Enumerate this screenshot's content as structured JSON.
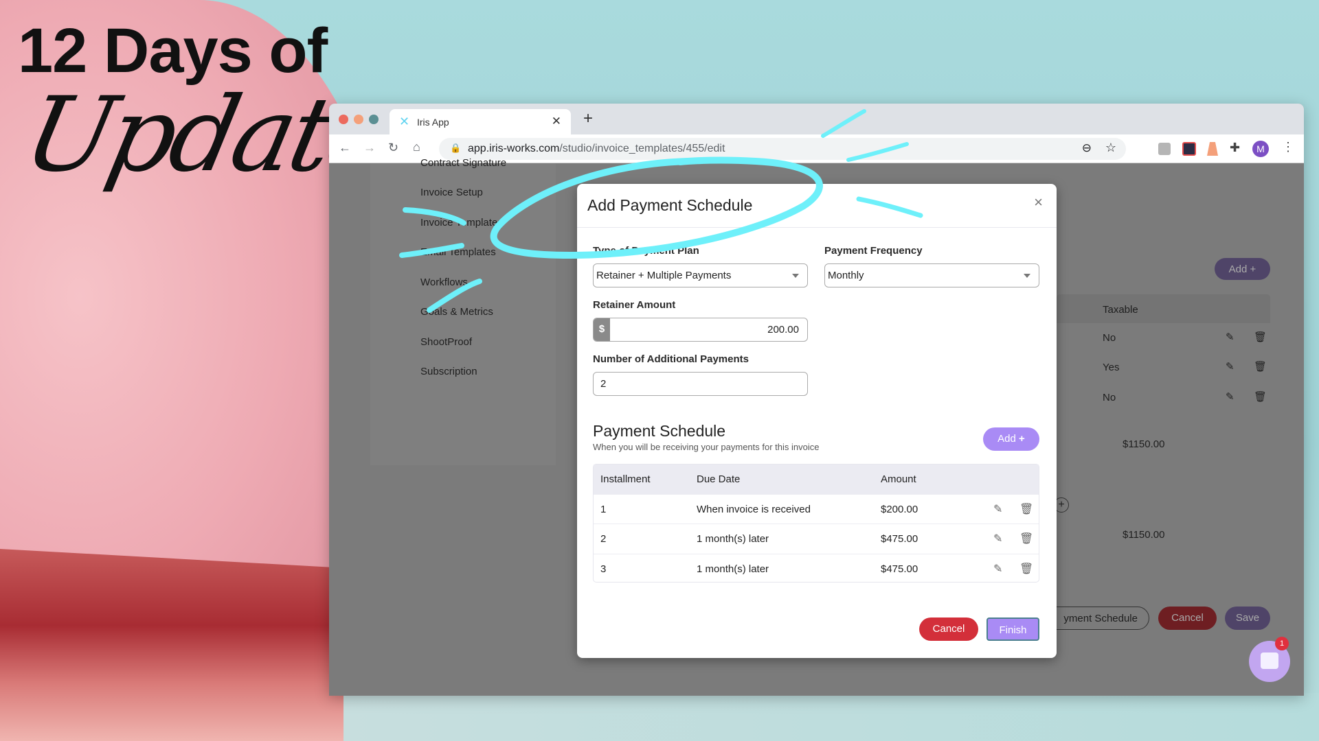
{
  "headline": {
    "line1": "12 Days of",
    "line2": "Updates"
  },
  "browser": {
    "tab_title": "Iris App",
    "url_host": "app.iris-works.com",
    "url_path": "/studio/invoice_templates/455/edit",
    "profile_initial": "M"
  },
  "sidebar": {
    "items": [
      {
        "label": "Contract Signature"
      },
      {
        "label": "Invoice Setup"
      },
      {
        "label": "Invoice Templates"
      },
      {
        "label": "Email Templates"
      },
      {
        "label": "Workflows"
      },
      {
        "label": "Goals & Metrics"
      },
      {
        "label": "ShootProof"
      },
      {
        "label": "Subscription"
      }
    ]
  },
  "background": {
    "add_label": "Add",
    "col_taxable": "Taxable",
    "taxable": [
      "No",
      "Yes",
      "No"
    ],
    "total1": "$1150.00",
    "total2": "$1150.00",
    "payment_schedule_btn": "yment Schedule",
    "cancel": "Cancel",
    "save": "Save",
    "chat_badge": "1"
  },
  "modal": {
    "title": "Add Payment Schedule",
    "close": "×",
    "plan_label": "Type of Payment Plan",
    "plan_value": "Retainer + Multiple Payments",
    "freq_label": "Payment Frequency",
    "freq_value": "Monthly",
    "retainer_label": "Retainer Amount",
    "currency": "$",
    "retainer_value": "200.00",
    "num_label": "Number of Additional Payments",
    "num_value": "2",
    "schedule_title": "Payment Schedule",
    "schedule_sub": "When you will be receiving your payments for this invoice",
    "add_label": "Add",
    "columns": [
      "Installment",
      "Due Date",
      "Amount"
    ],
    "rows": [
      {
        "n": "1",
        "due": "When invoice is received",
        "amount": "$200.00"
      },
      {
        "n": "2",
        "due": "1 month(s) later",
        "amount": "$475.00"
      },
      {
        "n": "3",
        "due": "1 month(s) later",
        "amount": "$475.00"
      }
    ],
    "cancel": "Cancel",
    "finish": "Finish"
  },
  "colors": {
    "accent": "#a98bf5",
    "danger": "#d32f3a",
    "annotation": "#6ef0fa"
  }
}
